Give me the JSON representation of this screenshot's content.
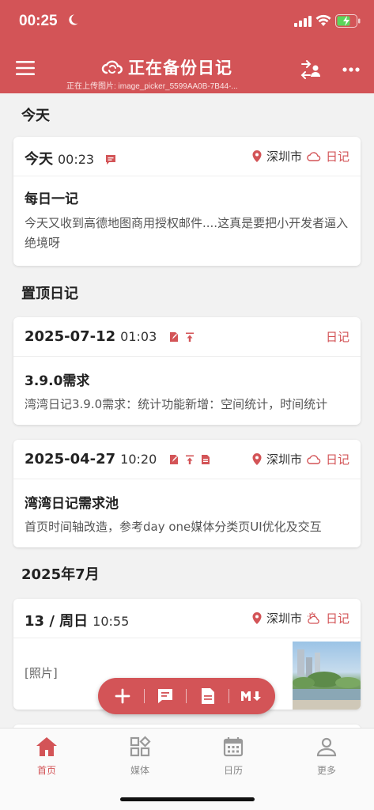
{
  "status_bar": {
    "time": "00:25"
  },
  "header": {
    "title": "正在备份日记",
    "subtitle": "正在上传图片: image_picker_5599AA0B-7B44-...",
    "icons": [
      "menu-icon",
      "cloud-sync-icon",
      "switch-account-icon",
      "more-icon"
    ]
  },
  "colors": {
    "brand": "#d35457"
  },
  "sections": {
    "today": "今天",
    "pinned": "置顶日记",
    "month": "2025年7月"
  },
  "entries": [
    {
      "date": "今天",
      "time": "00:23",
      "location": "深圳市",
      "tag": "日记",
      "title": "每日一记",
      "body": "今天又收到高德地图商用授权邮件....这真是要把小开发者逼入绝境呀"
    },
    {
      "date": "2025-07-12",
      "time": "01:03",
      "tag": "日记",
      "title": "3.9.0需求",
      "body": "湾湾日记3.9.0需求：统计功能新增：空间统计，时间统计"
    },
    {
      "date": "2025-04-27",
      "time": "10:20",
      "location": "深圳市",
      "tag": "日记",
      "title": "湾湾日记需求池",
      "body": "首页时间轴改造，参考day one媒体分类页UI优化及交互"
    },
    {
      "date": "13 / 周日",
      "time": "10:55",
      "location": "深圳市",
      "tag": "日记",
      "body": "[照片]"
    }
  ],
  "fab": {
    "icons": [
      "add-icon",
      "chat-note-icon",
      "document-icon",
      "markdown-icon"
    ]
  },
  "tabs": [
    {
      "label": "首页",
      "icon": "home-icon",
      "active": true
    },
    {
      "label": "媒体",
      "icon": "media-grid-icon"
    },
    {
      "label": "日历",
      "icon": "calendar-icon"
    },
    {
      "label": "更多",
      "icon": "person-icon"
    }
  ]
}
